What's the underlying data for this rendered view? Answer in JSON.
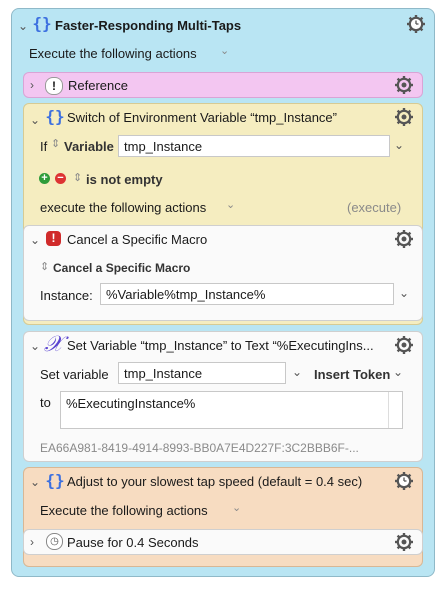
{
  "main": {
    "title": "Faster-Responding Multi-Taps",
    "execute_label": "Execute the following actions"
  },
  "reference": {
    "title": "Reference"
  },
  "switch": {
    "title": "Switch of Environment Variable “tmp_Instance”",
    "if_label": "If",
    "variable_label": "Variable",
    "variable_value": "tmp_Instance",
    "condition": "is not empty",
    "execute_label": "execute the following actions",
    "execute_tag": "(execute)"
  },
  "cancel": {
    "title": "Cancel a Specific Macro",
    "selector": "Cancel a Specific Macro",
    "instance_label": "Instance:",
    "instance_value": "%Variable%tmp_Instance%"
  },
  "setvar": {
    "title": "Set Variable “tmp_Instance” to Text “%ExecutingIns...",
    "set_label": "Set variable",
    "var_value": "tmp_Instance",
    "insert_token": "Insert Token",
    "to_label": "to",
    "text_value": "%ExecutingInstance%",
    "uuid": "EA66A981-8419-4914-8993-BB0A7E4D227F:3C2BBB6F-..."
  },
  "adjust": {
    "title": "Adjust to your slowest tap speed (default = 0.4 sec)",
    "execute_label": "Execute the following actions"
  },
  "pause": {
    "title": "Pause for 0.4 Seconds"
  },
  "colors": {
    "outer": "#b9e5f3",
    "reference": "#f3c6f1",
    "switch": "#f5edc0",
    "adjust": "#f7dcc1",
    "icon_blue": "#3b6fe0",
    "icon_red": "#d02b2b"
  }
}
